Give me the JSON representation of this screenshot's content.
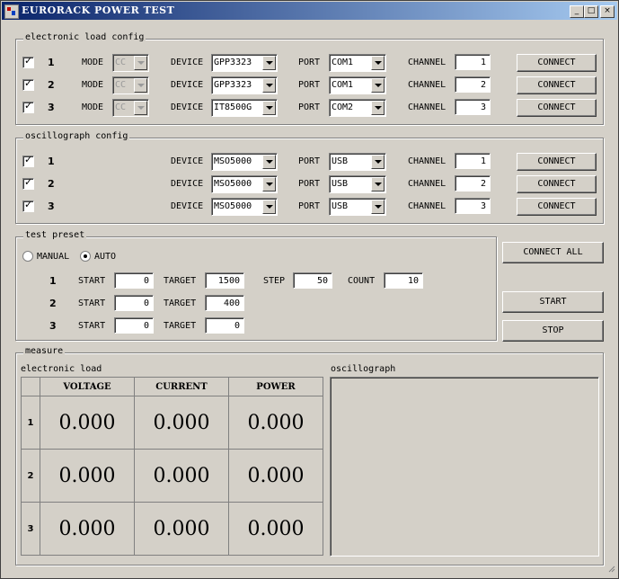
{
  "window": {
    "title": "EURORACK POWER TEST",
    "minimize": "_",
    "maximize": "□",
    "close": "×"
  },
  "eload": {
    "title": "electronic load config",
    "mode_label": "MODE",
    "device_label": "DEVICE",
    "port_label": "PORT",
    "channel_label": "CHANNEL",
    "rows": [
      {
        "num": "1",
        "mode": "CC",
        "device": "GPP3323",
        "port": "COM1",
        "channel": "1",
        "button": "CONNECT"
      },
      {
        "num": "2",
        "mode": "CC",
        "device": "GPP3323",
        "port": "COM1",
        "channel": "2",
        "button": "CONNECT"
      },
      {
        "num": "3",
        "mode": "CC",
        "device": "IT8500G",
        "port": "COM2",
        "channel": "3",
        "button": "CONNECT"
      }
    ]
  },
  "osc": {
    "title": "oscillograph config",
    "device_label": "DEVICE",
    "port_label": "PORT",
    "channel_label": "CHANNEL",
    "rows": [
      {
        "num": "1",
        "device": "MSO5000",
        "port": "USB",
        "channel": "1",
        "button": "CONNECT"
      },
      {
        "num": "2",
        "device": "MSO5000",
        "port": "USB",
        "channel": "2",
        "button": "CONNECT"
      },
      {
        "num": "3",
        "device": "MSO5000",
        "port": "USB",
        "channel": "3",
        "button": "CONNECT"
      }
    ]
  },
  "preset": {
    "title": "test preset",
    "manual": "MANUAL",
    "auto": "AUTO",
    "selected": "AUTO",
    "start_label": "START",
    "target_label": "TARGET",
    "step_label": "STEP",
    "count_label": "COUNT",
    "rows": [
      {
        "num": "1",
        "start": "0",
        "target": "1500",
        "step": "50",
        "count": "10"
      },
      {
        "num": "2",
        "start": "0",
        "target": "400"
      },
      {
        "num": "3",
        "start": "0",
        "target": "0"
      }
    ]
  },
  "actions": {
    "connect_all": "CONNECT ALL",
    "start": "START",
    "stop": "STOP"
  },
  "measure": {
    "title": "measure",
    "eload_label": "electronic load",
    "osc_label": "oscillograph",
    "columns": [
      "VOLTAGE",
      "CURRENT",
      "POWER"
    ],
    "rows": [
      {
        "num": "1",
        "voltage": "0.000",
        "current": "0.000",
        "power": "0.000"
      },
      {
        "num": "2",
        "voltage": "0.000",
        "current": "0.000",
        "power": "0.000"
      },
      {
        "num": "3",
        "voltage": "0.000",
        "current": "0.000",
        "power": "0.000"
      }
    ]
  }
}
